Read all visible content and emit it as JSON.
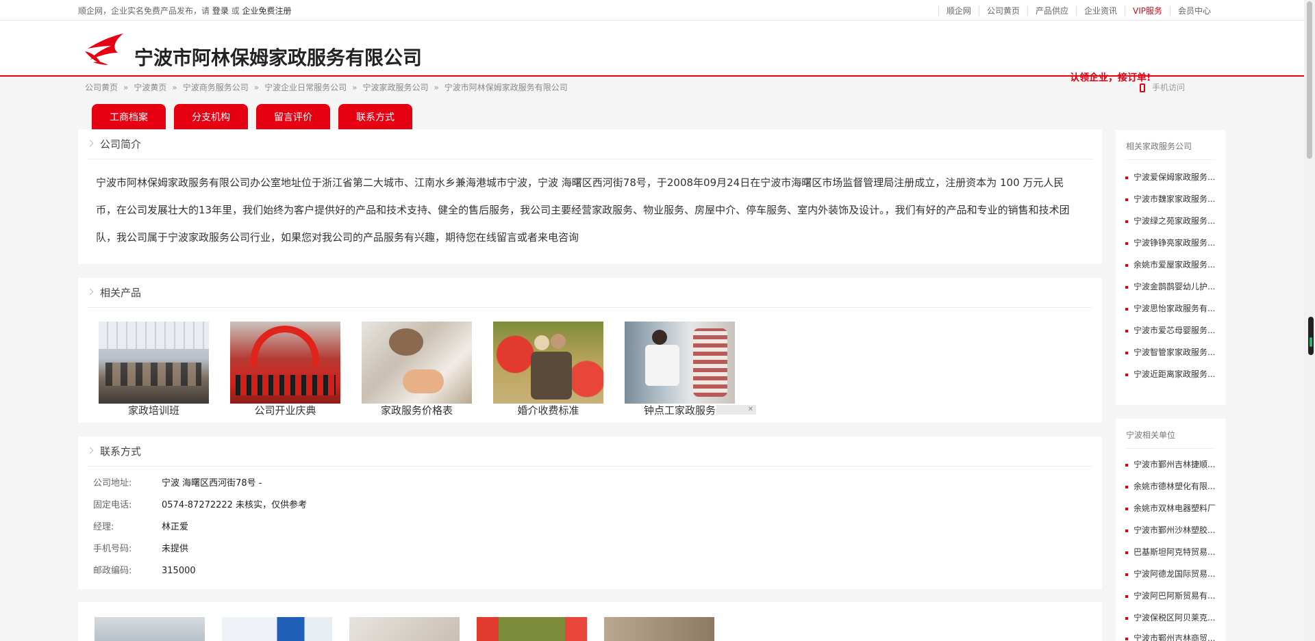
{
  "topbar": {
    "notice_prefix": "顺企网，企业实名免费产品发布，请",
    "login": "登录",
    "or": "或",
    "register": "企业免费注册",
    "links": [
      "顺企网",
      "公司黄页",
      "产品供应",
      "企业资讯",
      "VIP服务",
      "会员中心"
    ]
  },
  "header": {
    "company_name": "宁波市阿林保姆家政服务有限公司",
    "claim": "认领企业，接订单!"
  },
  "breadcrumb": [
    "公司黄页",
    "宁波黄页",
    "宁波商务服务公司",
    "宁波企业日常服务公司",
    "宁波家政服务公司",
    "宁波市阿林保姆家政服务有限公司"
  ],
  "mobile_visit": "手机访问",
  "tabs": [
    "工商档案",
    "分支机构",
    "留言评价",
    "联系方式"
  ],
  "intro": {
    "title": "公司简介",
    "text": "宁波市阿林保姆家政服务有限公司办公室地址位于浙江省第二大城市、江南水乡兼海港城市宁波，宁波 海曙区西河街78号，于2008年09月24日在宁波市海曙区市场监督管理局注册成立，注册资本为 100 万元人民币，在公司发展壮大的13年里，我们始终为客户提供好的产品和技术支持、健全的售后服务，我公司主要经营家政服务、物业服务、房屋中介、停车服务、室内外装饰及设计。，我们有好的产品和专业的销售和技术团队，我公司属于宁波家政服务公司行业，如果您对我公司的产品服务有兴趣，期待您在线留言或者来电咨询"
  },
  "products": {
    "title": "相关产品",
    "items": [
      "家政培训班",
      "公司开业庆典",
      "家政服务价格表",
      "婚介收费标准",
      "钟点工家政服务"
    ]
  },
  "contact": {
    "title": "联系方式",
    "rows": [
      {
        "k": "公司地址:",
        "v": "宁波 海曙区西河街78号 -"
      },
      {
        "k": "固定电话:",
        "v": "0574-87272222 未核实，仅供参考"
      },
      {
        "k": "经理:",
        "v": "林正爱"
      },
      {
        "k": "手机号码:",
        "v": "未提供"
      },
      {
        "k": "邮政编码:",
        "v": "315000"
      }
    ]
  },
  "sidebar_related": {
    "title": "相关家政服务公司",
    "items": [
      "宁波爱保姆家政服务...",
      "宁波市魏家家政服务...",
      "宁波绿之苑家政服务...",
      "宁波铮铮亮家政服务...",
      "余姚市爱屋家政服务...",
      "宁波金鹊鹊婴幼儿护...",
      "宁波思怡家政服务有...",
      "宁波市爱芯母婴服务...",
      "宁波智管家家政服务...",
      "宁波近距离家政服务..."
    ]
  },
  "sidebar_local": {
    "title": "宁波相关单位",
    "items": [
      "宁波市鄞州吉林捷顺...",
      "余姚市德林塑化有限...",
      "余姚市双林电器塑料厂",
      "宁波市鄞州沙林塑胶...",
      "巴基斯坦阿克特贸易...",
      "宁波阿德龙国际贸易...",
      "宁波阿巴阿斯贸易有...",
      "宁波保税区阿贝莱克...",
      "宁波市鄞州吉林商贸..."
    ]
  },
  "colors": {
    "accent": "#e60012"
  }
}
